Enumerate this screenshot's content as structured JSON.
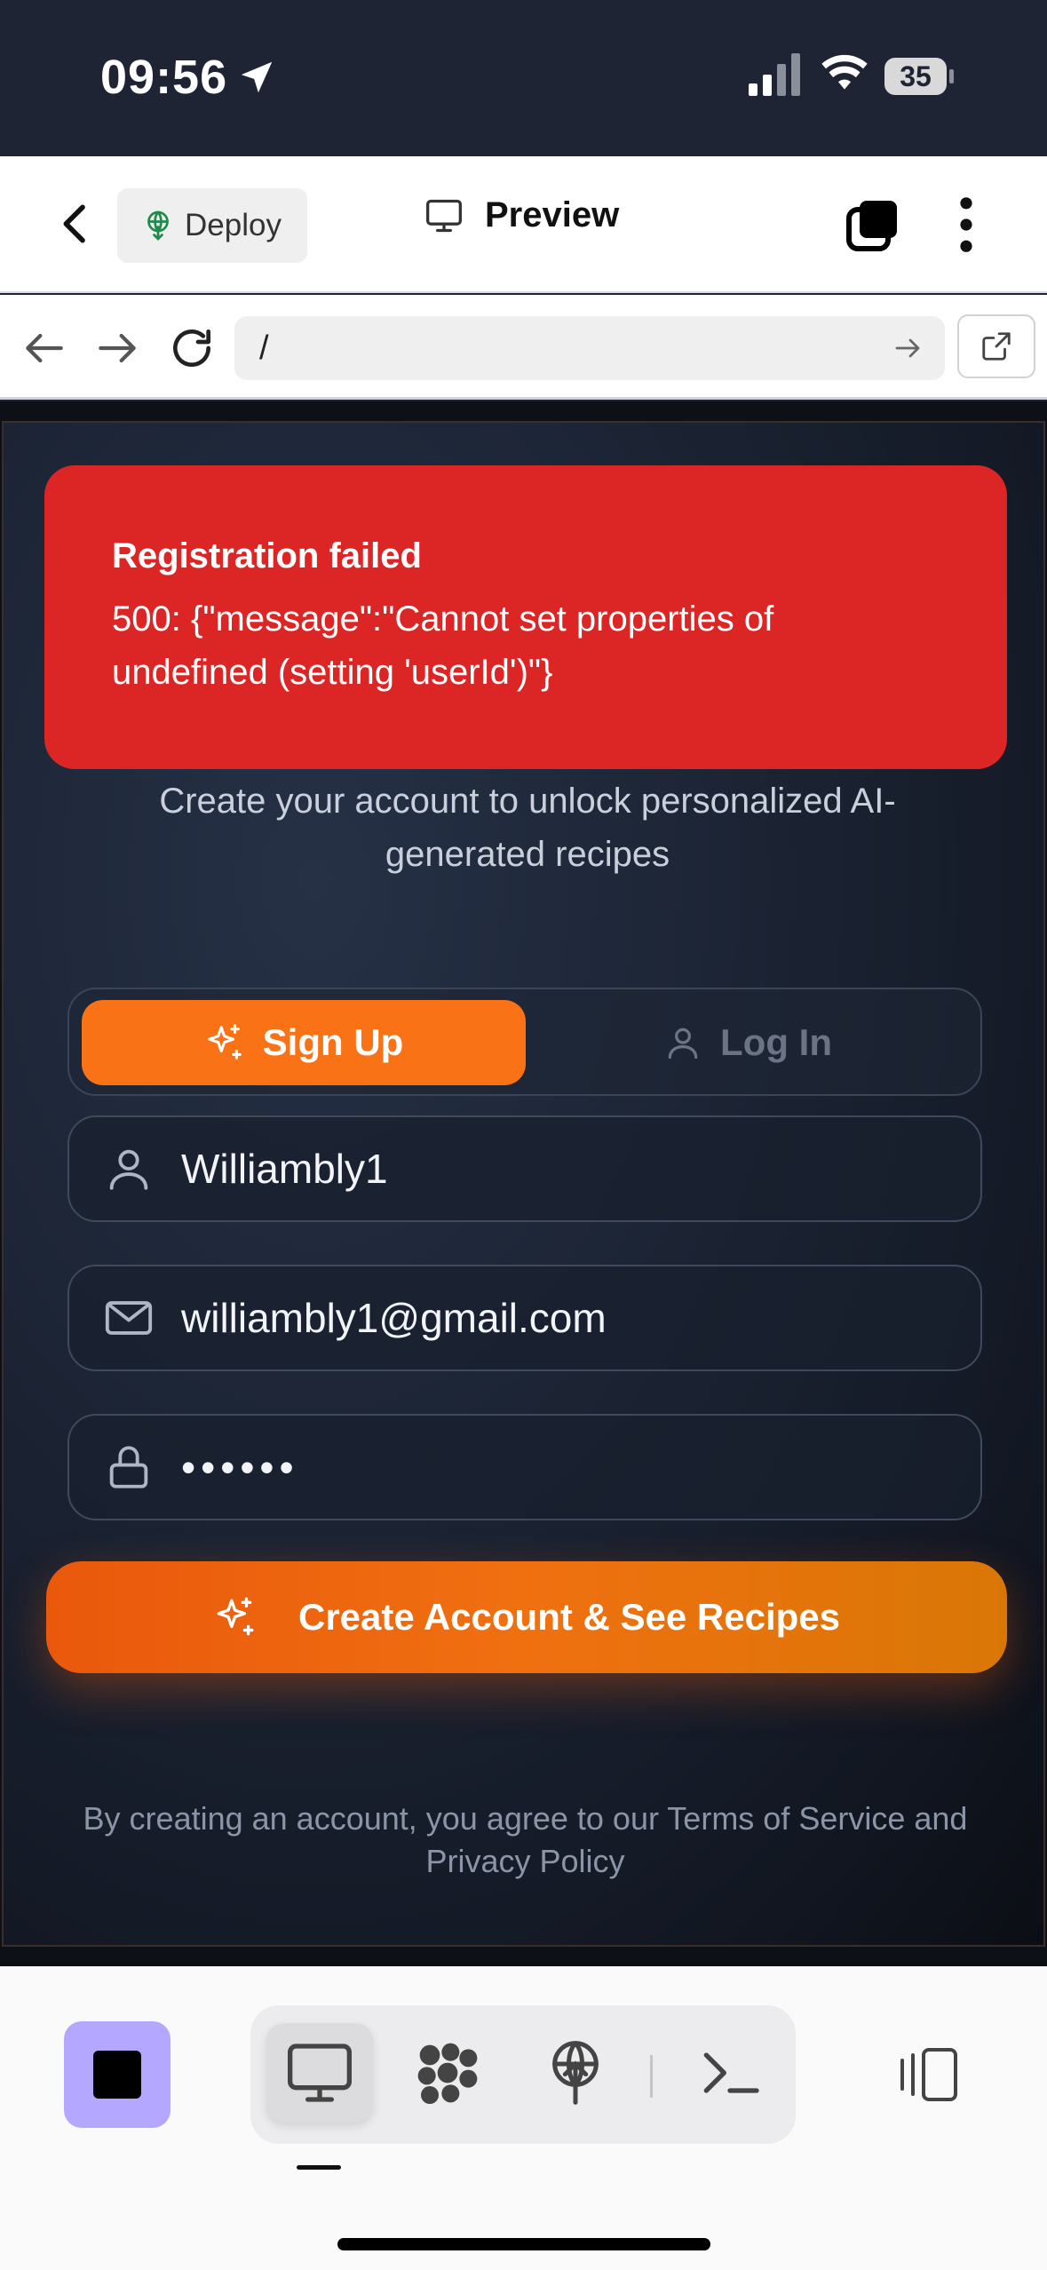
{
  "status_bar": {
    "time": "09:56",
    "battery": "35"
  },
  "app_bar": {
    "deploy_label": "Deploy",
    "preview_label": "Preview"
  },
  "url_bar": {
    "url": "/"
  },
  "toast": {
    "title": "Registration failed",
    "message": "500: {\"message\":\"Cannot set properties of undefined (setting 'userId')\"}"
  },
  "form": {
    "subtitle": "Create your account to unlock personalized AI-generated recipes",
    "tab_signup": "Sign Up",
    "tab_login": "Log In",
    "username_value": "Williambly1",
    "email_value": "williambly1@gmail.com",
    "password_value": "••••••",
    "submit_label": "Create Account & See Recipes",
    "legal_text": "By creating an account, you agree to our Terms of Service and Privacy Policy"
  },
  "colors": {
    "accent": "#f97316",
    "error": "#dc2626",
    "stop_button": "#b4a7ff"
  },
  "icons": {
    "status": [
      "location-arrow-icon",
      "signal-icon",
      "wifi-icon",
      "battery-icon"
    ],
    "app_bar": [
      "chevron-left-icon",
      "globe-deploy-icon",
      "monitor-icon",
      "tabs-icon",
      "more-vertical-icon"
    ],
    "url_bar": [
      "arrow-left-icon",
      "arrow-right-icon",
      "reload-icon",
      "arrow-go-icon",
      "external-link-icon"
    ],
    "form": [
      "sparkles-icon",
      "user-icon",
      "mail-icon",
      "lock-icon"
    ],
    "bottom": [
      "stop-icon",
      "monitor-icon",
      "apps-grid-icon",
      "deploy-icon",
      "terminal-icon",
      "split-view-icon"
    ]
  }
}
